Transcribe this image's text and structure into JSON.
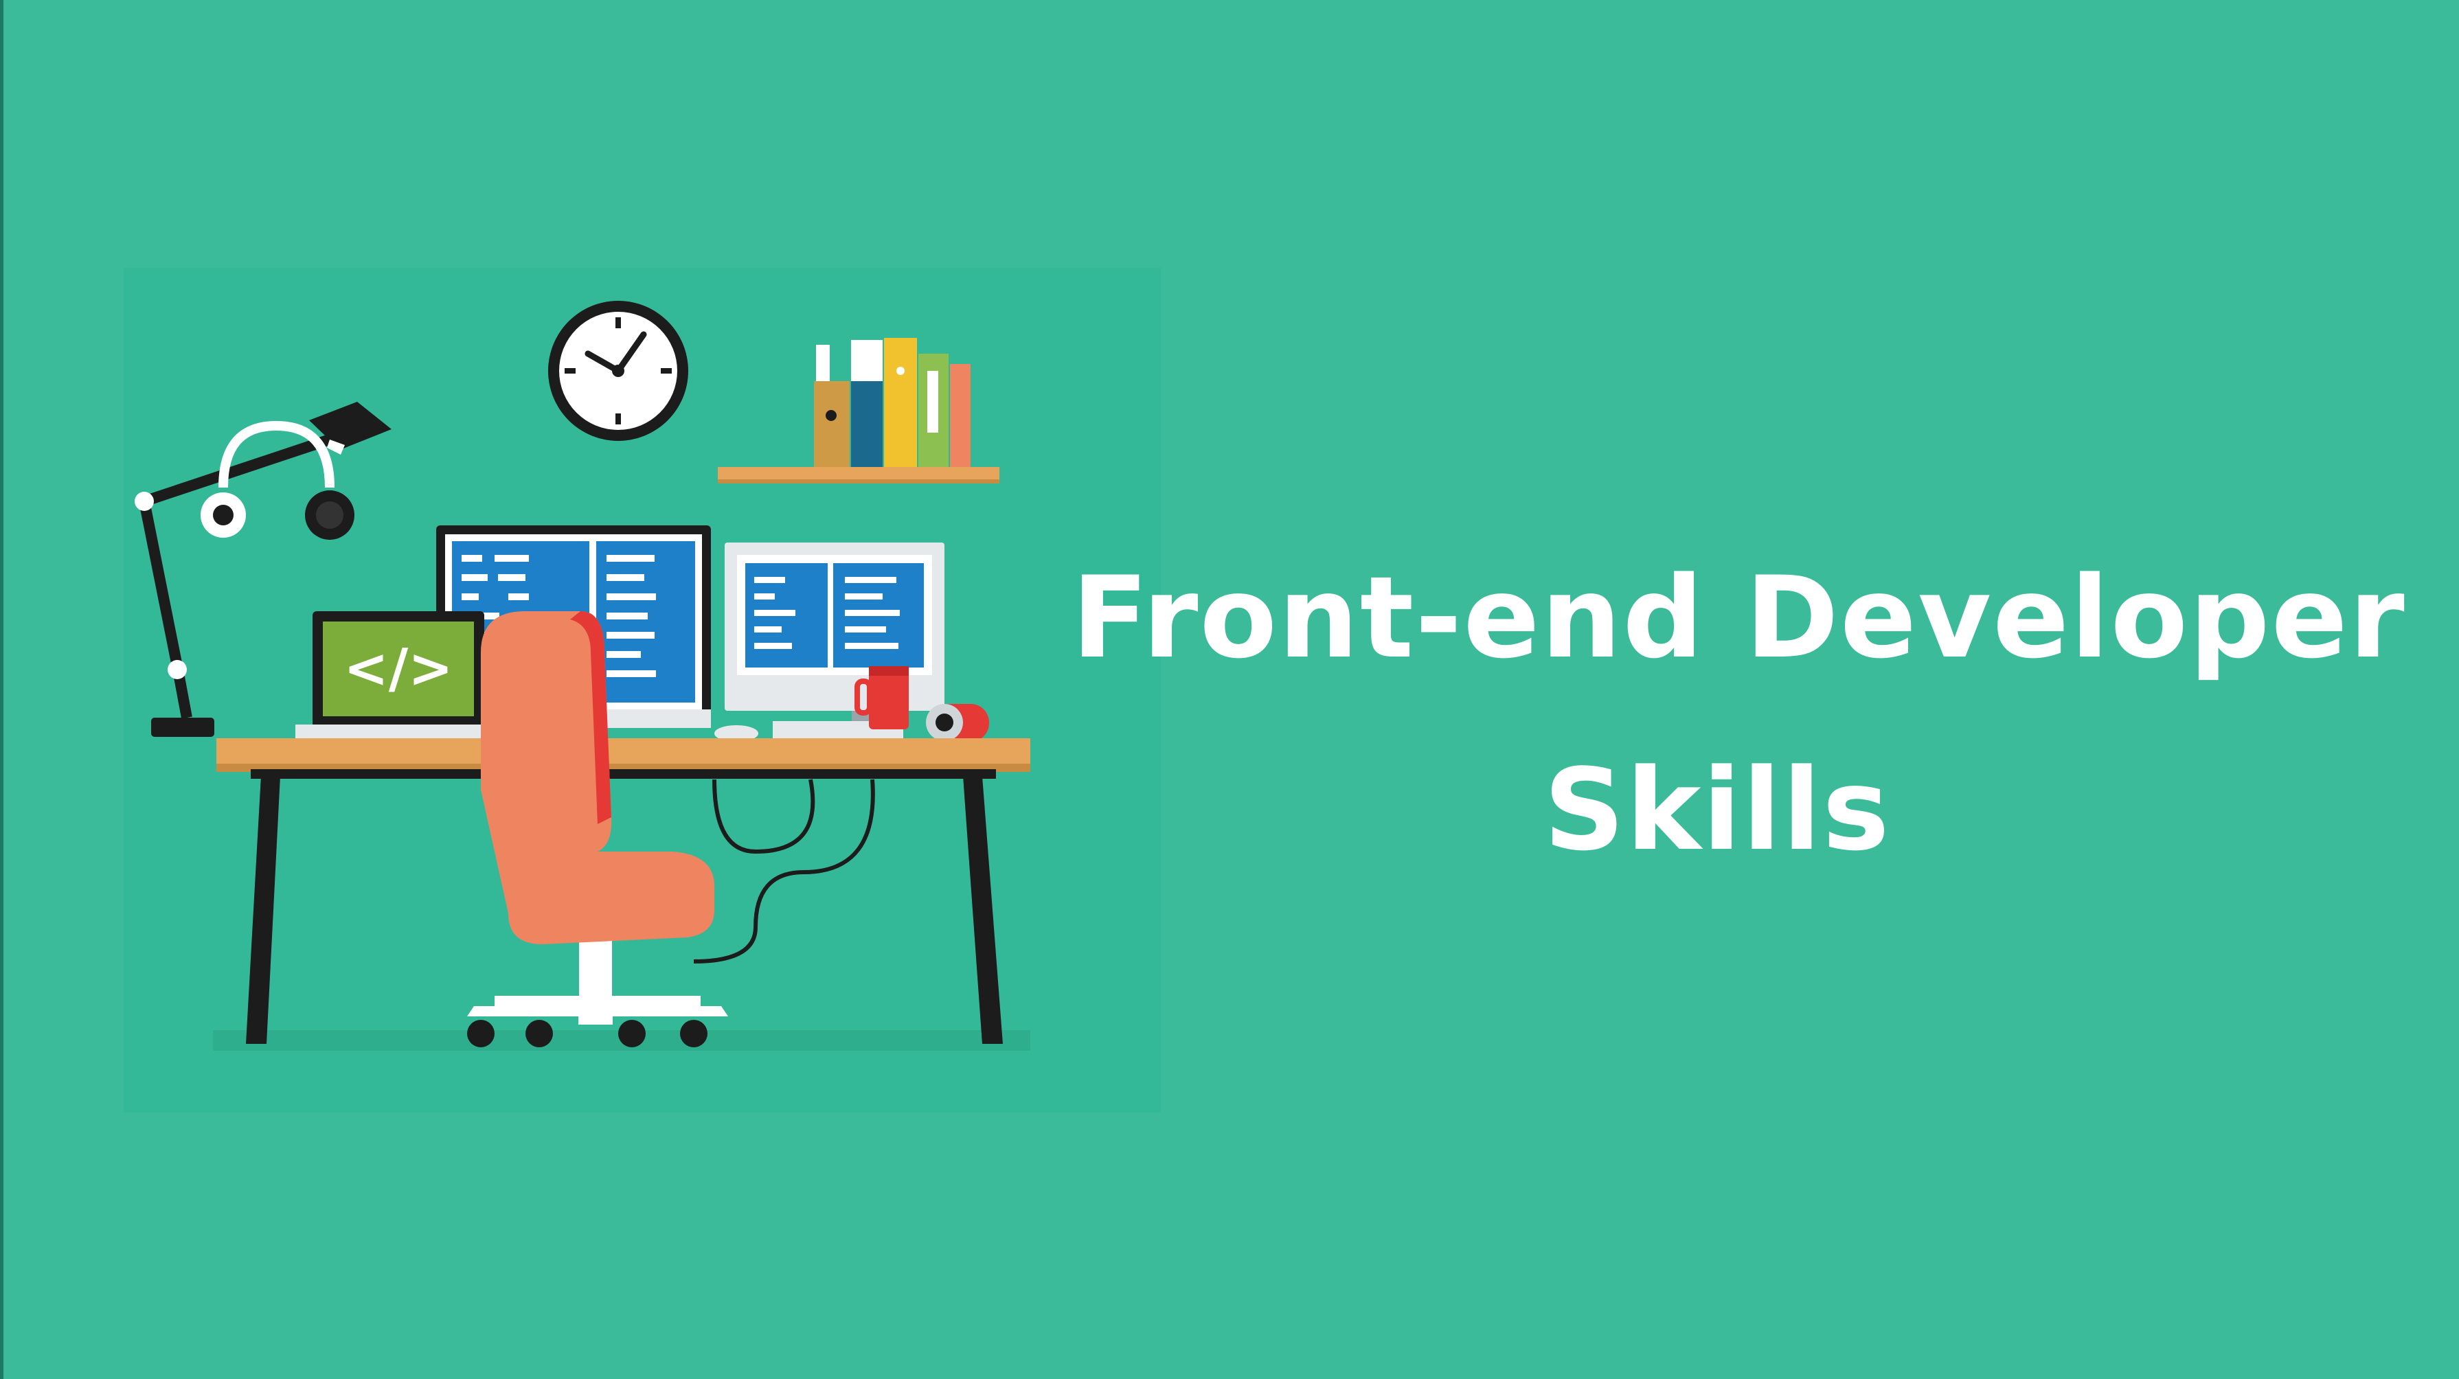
{
  "colors": {
    "background": "#3cbb9a",
    "illustration_background": "#34b998",
    "desk_top": "#e6a55a",
    "desk_legs": "#1c1c1c",
    "chair": "#ee8560",
    "chair_back_edge": "#e53935",
    "screen_blue": "#1e80c8",
    "laptop_screen": "#7cad3a",
    "headline_text": "#ffffff"
  },
  "illustration": {
    "laptop_code_glyph": "</>",
    "icons": [
      "desk-lamp-icon",
      "headphones-icon",
      "wall-clock-icon",
      "bookshelf-icon",
      "books-icon",
      "monitor-icon",
      "laptop-icon",
      "office-chair-icon",
      "coffee-mug-icon",
      "tape-roll-icon",
      "desk-icon"
    ]
  },
  "headline": {
    "line1": "Front-end Developer",
    "line2": "Skills"
  }
}
